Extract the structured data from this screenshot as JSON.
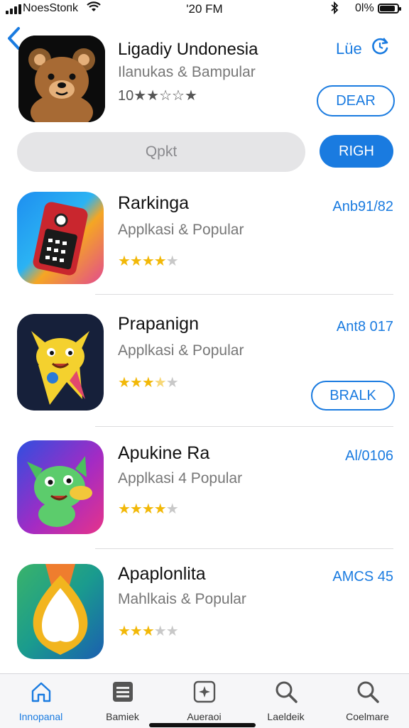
{
  "status_bar": {
    "carrier": "NoesStoпk",
    "time": "'20 FM",
    "battery": "0l%"
  },
  "header": {
    "back_icon": "chevron-left-icon",
    "title": "Ligadiy Undonesia",
    "subtitle": "Ilanukas & Bampular",
    "rating_text": "10★★☆☆★",
    "link_label": "Lüe",
    "clear_button": "DEAR"
  },
  "search": {
    "placeholder": "Qpkt",
    "button_label": "RIGH"
  },
  "list": [
    {
      "title": "Rarkinga",
      "subtitle": "Applkasi & Popular",
      "price": "Anb91/82",
      "stars": 4,
      "action": ""
    },
    {
      "title": "Prapanign",
      "subtitle": "Applkasi & Popular",
      "price": "Ant8 017",
      "stars": 3.5,
      "action": "BRALK"
    },
    {
      "title": "Apukine Ra",
      "subtitle": "Applkasi 4 Popular",
      "price": "Al/0106",
      "stars": 4,
      "action": ""
    },
    {
      "title": "Apaplonlita",
      "subtitle": "Mahlkais & Popular",
      "price": "AMCS 45",
      "stars": 3,
      "action": ""
    }
  ],
  "tabs": [
    {
      "label": "Innopanal",
      "icon": "home-icon",
      "active": true
    },
    {
      "label": "Bamiek",
      "icon": "list-icon",
      "active": false
    },
    {
      "label": "Aueraoi",
      "icon": "games-icon",
      "active": false
    },
    {
      "label": "Laeldeik",
      "icon": "search-icon",
      "active": false
    },
    {
      "label": "Coelmare",
      "icon": "search-icon",
      "active": false
    }
  ],
  "colors": {
    "accent": "#1a7be0",
    "star": "#f2b807",
    "search_bg": "#e5e5e7"
  }
}
